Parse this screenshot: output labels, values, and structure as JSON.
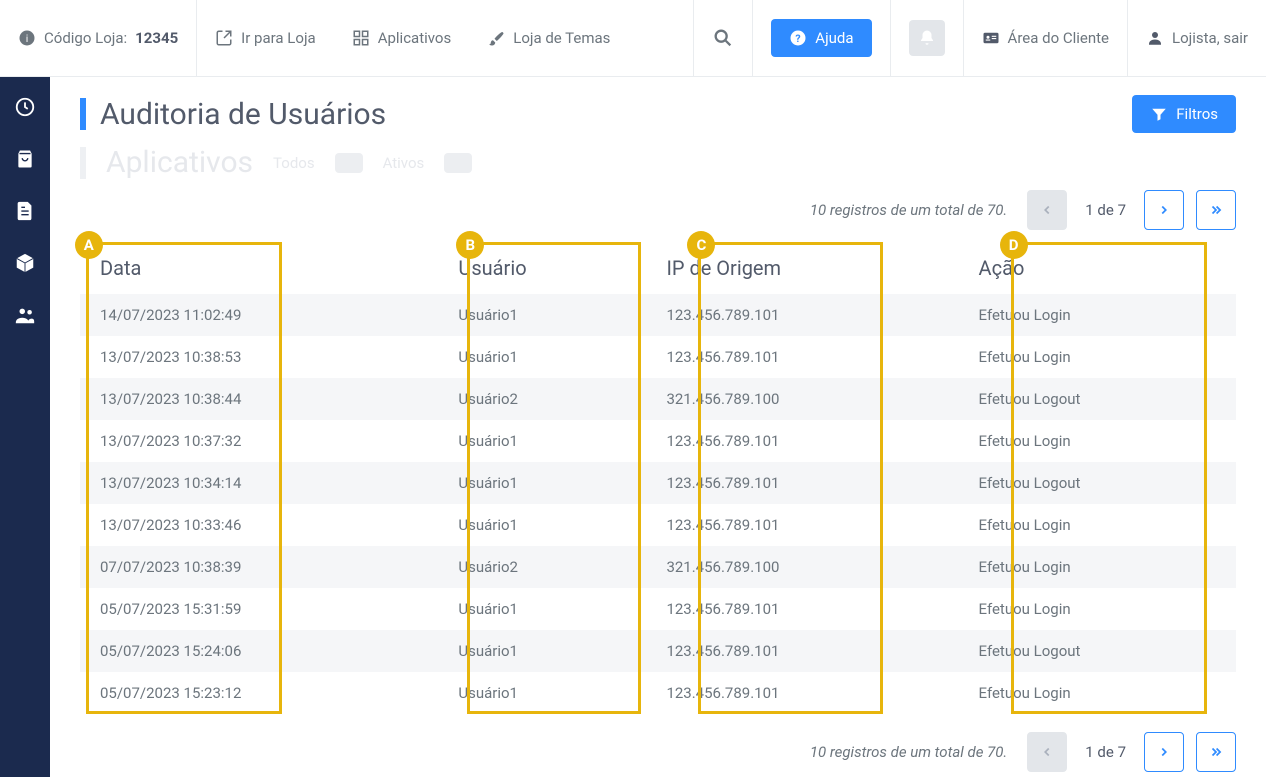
{
  "topbar": {
    "codigo_label": "Código Loja: ",
    "codigo_value": "12345",
    "ir_para_loja": "Ir para Loja",
    "aplicativos": "Aplicativos",
    "loja_temas": "Loja de Temas",
    "ajuda": "Ajuda",
    "area_cliente": "Área do Cliente",
    "lojista": "Lojista, sair"
  },
  "page": {
    "title": "Auditoria de Usuários",
    "ghost_title": "Aplicativos",
    "ghost_todos": "Todos",
    "ghost_ativos": "Ativos",
    "filtros": "Filtros"
  },
  "pager": {
    "summary": "10 registros de um total de 70.",
    "info": "1 de 7"
  },
  "table": {
    "headers": {
      "data": "Data",
      "usuario": "Usuário",
      "ip": "IP de Origem",
      "acao": "Ação"
    },
    "annotations": [
      "A",
      "B",
      "C",
      "D"
    ],
    "rows": [
      {
        "data": "14/07/2023 11:02:49",
        "usuario": "Usuário1",
        "ip": "123.456.789.101",
        "acao": "Efetuou Login"
      },
      {
        "data": "13/07/2023 10:38:53",
        "usuario": "Usuário1",
        "ip": "123.456.789.101",
        "acao": "Efetuou Login"
      },
      {
        "data": "13/07/2023 10:38:44",
        "usuario": "Usuário2",
        "ip": "321.456.789.100",
        "acao": "Efetuou Logout"
      },
      {
        "data": "13/07/2023 10:37:32",
        "usuario": "Usuário1",
        "ip": "123.456.789.101",
        "acao": "Efetuou Login"
      },
      {
        "data": "13/07/2023 10:34:14",
        "usuario": "Usuário1",
        "ip": "123.456.789.101",
        "acao": "Efetuou Logout"
      },
      {
        "data": "13/07/2023 10:33:46",
        "usuario": "Usuário1",
        "ip": "123.456.789.101",
        "acao": "Efetuou Login"
      },
      {
        "data": "07/07/2023 10:38:39",
        "usuario": "Usuário2",
        "ip": "321.456.789.100",
        "acao": "Efetuou Login"
      },
      {
        "data": "05/07/2023 15:31:59",
        "usuario": "Usuário1",
        "ip": "123.456.789.101",
        "acao": "Efetuou Login"
      },
      {
        "data": "05/07/2023 15:24:06",
        "usuario": "Usuário1",
        "ip": "123.456.789.101",
        "acao": "Efetuou Logout"
      },
      {
        "data": "05/07/2023 15:23:12",
        "usuario": "Usuário1",
        "ip": "123.456.789.101",
        "acao": "Efetuou Login"
      }
    ]
  }
}
